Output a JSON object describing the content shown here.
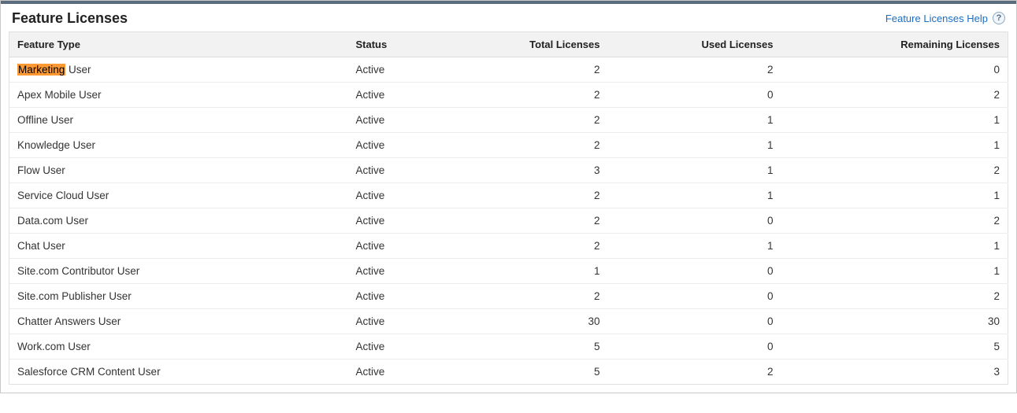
{
  "header": {
    "title": "Feature Licenses",
    "help_link": "Feature Licenses Help",
    "help_icon_char": "?"
  },
  "table": {
    "columns": {
      "feature_type": "Feature Type",
      "status": "Status",
      "total": "Total Licenses",
      "used": "Used Licenses",
      "remaining": "Remaining Licenses"
    },
    "rows": [
      {
        "highlight_prefix": "Marketing",
        "feature_rest": " User",
        "status": "Active",
        "total": 2,
        "used": 2,
        "remaining": 0
      },
      {
        "feature": "Apex Mobile User",
        "status": "Active",
        "total": 2,
        "used": 0,
        "remaining": 2
      },
      {
        "feature": "Offline User",
        "status": "Active",
        "total": 2,
        "used": 1,
        "remaining": 1
      },
      {
        "feature": "Knowledge User",
        "status": "Active",
        "total": 2,
        "used": 1,
        "remaining": 1
      },
      {
        "feature": "Flow User",
        "status": "Active",
        "total": 3,
        "used": 1,
        "remaining": 2
      },
      {
        "feature": "Service Cloud User",
        "status": "Active",
        "total": 2,
        "used": 1,
        "remaining": 1
      },
      {
        "feature": "Data.com User",
        "status": "Active",
        "total": 2,
        "used": 0,
        "remaining": 2
      },
      {
        "feature": "Chat User",
        "status": "Active",
        "total": 2,
        "used": 1,
        "remaining": 1
      },
      {
        "feature": "Site.com Contributor User",
        "status": "Active",
        "total": 1,
        "used": 0,
        "remaining": 1
      },
      {
        "feature": "Site.com Publisher User",
        "status": "Active",
        "total": 2,
        "used": 0,
        "remaining": 2
      },
      {
        "feature": "Chatter Answers User",
        "status": "Active",
        "total": 30,
        "used": 0,
        "remaining": 30
      },
      {
        "feature": "Work.com User",
        "status": "Active",
        "total": 5,
        "used": 0,
        "remaining": 5
      },
      {
        "feature": "Salesforce CRM Content User",
        "status": "Active",
        "total": 5,
        "used": 2,
        "remaining": 3
      }
    ]
  }
}
